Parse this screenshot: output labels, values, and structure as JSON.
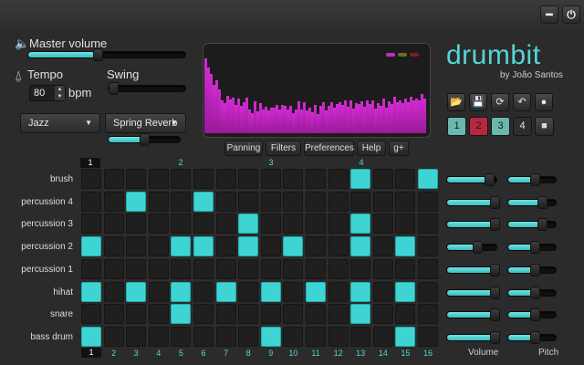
{
  "window": {
    "minimize_label": "━",
    "close_label": "⏻"
  },
  "master_volume": {
    "label": "Master volume",
    "icon": "speaker-icon",
    "value": 0.44
  },
  "tempo": {
    "label": "Tempo",
    "icon": "metronome-icon",
    "value": "80",
    "unit": "bpm"
  },
  "swing": {
    "label": "Swing",
    "value": 0.0
  },
  "style_dropdown": {
    "selected": "Jazz"
  },
  "reverb_dropdown": {
    "selected": "Spring Reverb"
  },
  "reverb_amount": {
    "value": 0.5
  },
  "visualizer": {
    "led_colors": [
      "#c030c0",
      "#6a6a2a",
      "#7a2020"
    ],
    "levels": [
      0.85,
      0.75,
      0.68,
      0.55,
      0.6,
      0.5,
      0.38,
      0.34,
      0.43,
      0.39,
      0.41,
      0.32,
      0.4,
      0.31,
      0.35,
      0.41,
      0.27,
      0.23,
      0.36,
      0.25,
      0.34,
      0.27,
      0.3,
      0.26,
      0.29,
      0.29,
      0.32,
      0.27,
      0.32,
      0.31,
      0.27,
      0.31,
      0.23,
      0.27,
      0.36,
      0.27,
      0.35,
      0.26,
      0.29,
      0.24,
      0.32,
      0.22,
      0.31,
      0.35,
      0.26,
      0.31,
      0.35,
      0.29,
      0.33,
      0.35,
      0.32,
      0.37,
      0.3,
      0.38,
      0.28,
      0.34,
      0.33,
      0.36,
      0.3,
      0.37,
      0.33,
      0.38,
      0.28,
      0.34,
      0.31,
      0.4,
      0.29,
      0.36,
      0.33,
      0.42,
      0.35,
      0.38,
      0.34,
      0.4,
      0.35,
      0.42,
      0.37,
      0.4,
      0.38,
      0.45,
      0.4
    ]
  },
  "tabs": {
    "panning": "Panning",
    "filters": "Filters",
    "preferences": "Preferences",
    "help": "Help",
    "gplus": "g+"
  },
  "brand": {
    "name": "drumbit",
    "byline": "by João Santos"
  },
  "toolbar": {
    "open": "📂",
    "save": "💾",
    "refresh": "⟳",
    "undo": "↶",
    "record": "●"
  },
  "patterns": {
    "p1": "1",
    "p2": "2",
    "p3": "3",
    "p4": "4",
    "stop": "■"
  },
  "pattern_colors": {
    "p1": "#6bb7b0",
    "p2": "#b8273f",
    "p3": "#6bb7b0",
    "p4": "#2d2d2d"
  },
  "beat_markers": {
    "m1": "1",
    "m2": "2",
    "m3": "3",
    "m4": "4"
  },
  "step_numbers": [
    "1",
    "2",
    "3",
    "4",
    "5",
    "6",
    "7",
    "8",
    "9",
    "10",
    "11",
    "12",
    "13",
    "14",
    "15",
    "16"
  ],
  "tracks": [
    {
      "name": "brush",
      "steps": [
        0,
        0,
        0,
        0,
        0,
        0,
        0,
        0,
        0,
        0,
        0,
        0,
        1,
        0,
        0,
        1
      ],
      "volume": 0.84,
      "pitch": 0.55
    },
    {
      "name": "percussion 4",
      "steps": [
        0,
        0,
        1,
        0,
        0,
        1,
        0,
        0,
        0,
        0,
        0,
        0,
        0,
        0,
        0,
        0
      ],
      "volume": 0.94,
      "pitch": 0.7
    },
    {
      "name": "percussion 3",
      "steps": [
        0,
        0,
        0,
        0,
        0,
        0,
        0,
        1,
        0,
        0,
        0,
        0,
        1,
        0,
        0,
        0
      ],
      "volume": 0.94,
      "pitch": 0.7
    },
    {
      "name": "percussion 2",
      "steps": [
        1,
        0,
        0,
        0,
        1,
        1,
        0,
        1,
        0,
        1,
        0,
        0,
        1,
        0,
        1,
        0
      ],
      "volume": 0.6,
      "pitch": 0.55
    },
    {
      "name": "percussion 1",
      "steps": [
        0,
        0,
        0,
        0,
        0,
        0,
        0,
        0,
        0,
        0,
        0,
        0,
        0,
        0,
        0,
        0
      ],
      "volume": 0.94,
      "pitch": 0.55
    },
    {
      "name": "hihat",
      "steps": [
        1,
        0,
        1,
        0,
        1,
        0,
        1,
        0,
        1,
        0,
        1,
        0,
        1,
        0,
        1,
        0
      ],
      "volume": 0.94,
      "pitch": 0.55
    },
    {
      "name": "snare",
      "steps": [
        0,
        0,
        0,
        0,
        1,
        0,
        0,
        0,
        0,
        0,
        0,
        0,
        1,
        0,
        0,
        0
      ],
      "volume": 0.94,
      "pitch": 0.55
    },
    {
      "name": "bass drum",
      "steps": [
        1,
        0,
        0,
        0,
        0,
        0,
        0,
        0,
        1,
        0,
        0,
        0,
        0,
        0,
        1,
        0
      ],
      "volume": 0.94,
      "pitch": 0.55
    }
  ],
  "column_labels": {
    "volume": "Volume",
    "pitch": "Pitch"
  }
}
